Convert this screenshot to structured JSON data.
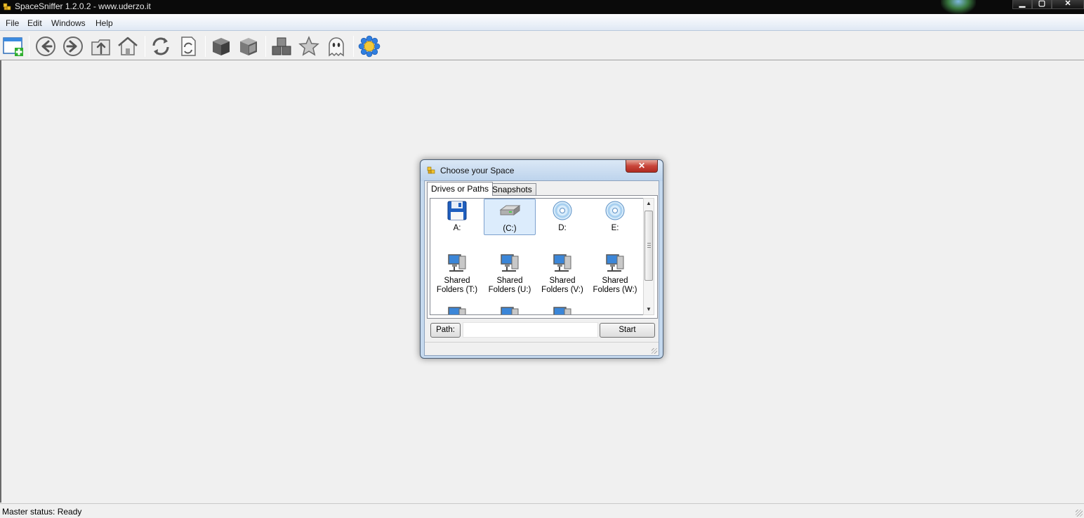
{
  "window": {
    "title": "SpaceSniffer 1.2.0.2 - www.uderzo.it",
    "controls": {
      "minimize": "▁",
      "maximize": "▢",
      "close": "✕"
    }
  },
  "menu": {
    "items": [
      "File",
      "Edit",
      "Windows",
      "Help"
    ]
  },
  "toolbar": {
    "buttons": [
      "new-window-icon",
      "back-icon",
      "forward-icon",
      "up-folder-icon",
      "home-icon",
      "refresh-icon",
      "refresh-document-icon",
      "box-icon",
      "box-open-icon",
      "blocks-icon",
      "star-icon",
      "ghost-icon",
      "flower-icon"
    ]
  },
  "status": {
    "text": "Master status: Ready"
  },
  "dialog": {
    "title": "Choose your Space",
    "close": "✕",
    "tabs": [
      "Drives or Paths",
      "Snapshots"
    ],
    "drives": [
      {
        "label": "A:",
        "icon": "floppy-disk-icon",
        "selected": false
      },
      {
        "label": "(C:)",
        "icon": "hard-drive-icon",
        "selected": true
      },
      {
        "label": "D:",
        "icon": "cd-drive-icon",
        "selected": false
      },
      {
        "label": "E:",
        "icon": "cd-drive-icon",
        "selected": false
      },
      {
        "label": "Shared Folders (T:)",
        "icon": "network-drive-icon",
        "selected": false
      },
      {
        "label": "Shared Folders (U:)",
        "icon": "network-drive-icon",
        "selected": false
      },
      {
        "label": "Shared Folders (V:)",
        "icon": "network-drive-icon",
        "selected": false
      },
      {
        "label": "Shared Folders (W:)",
        "icon": "network-drive-icon",
        "selected": false
      }
    ],
    "path_label": "Path:",
    "path_value": "",
    "start_label": "Start"
  }
}
